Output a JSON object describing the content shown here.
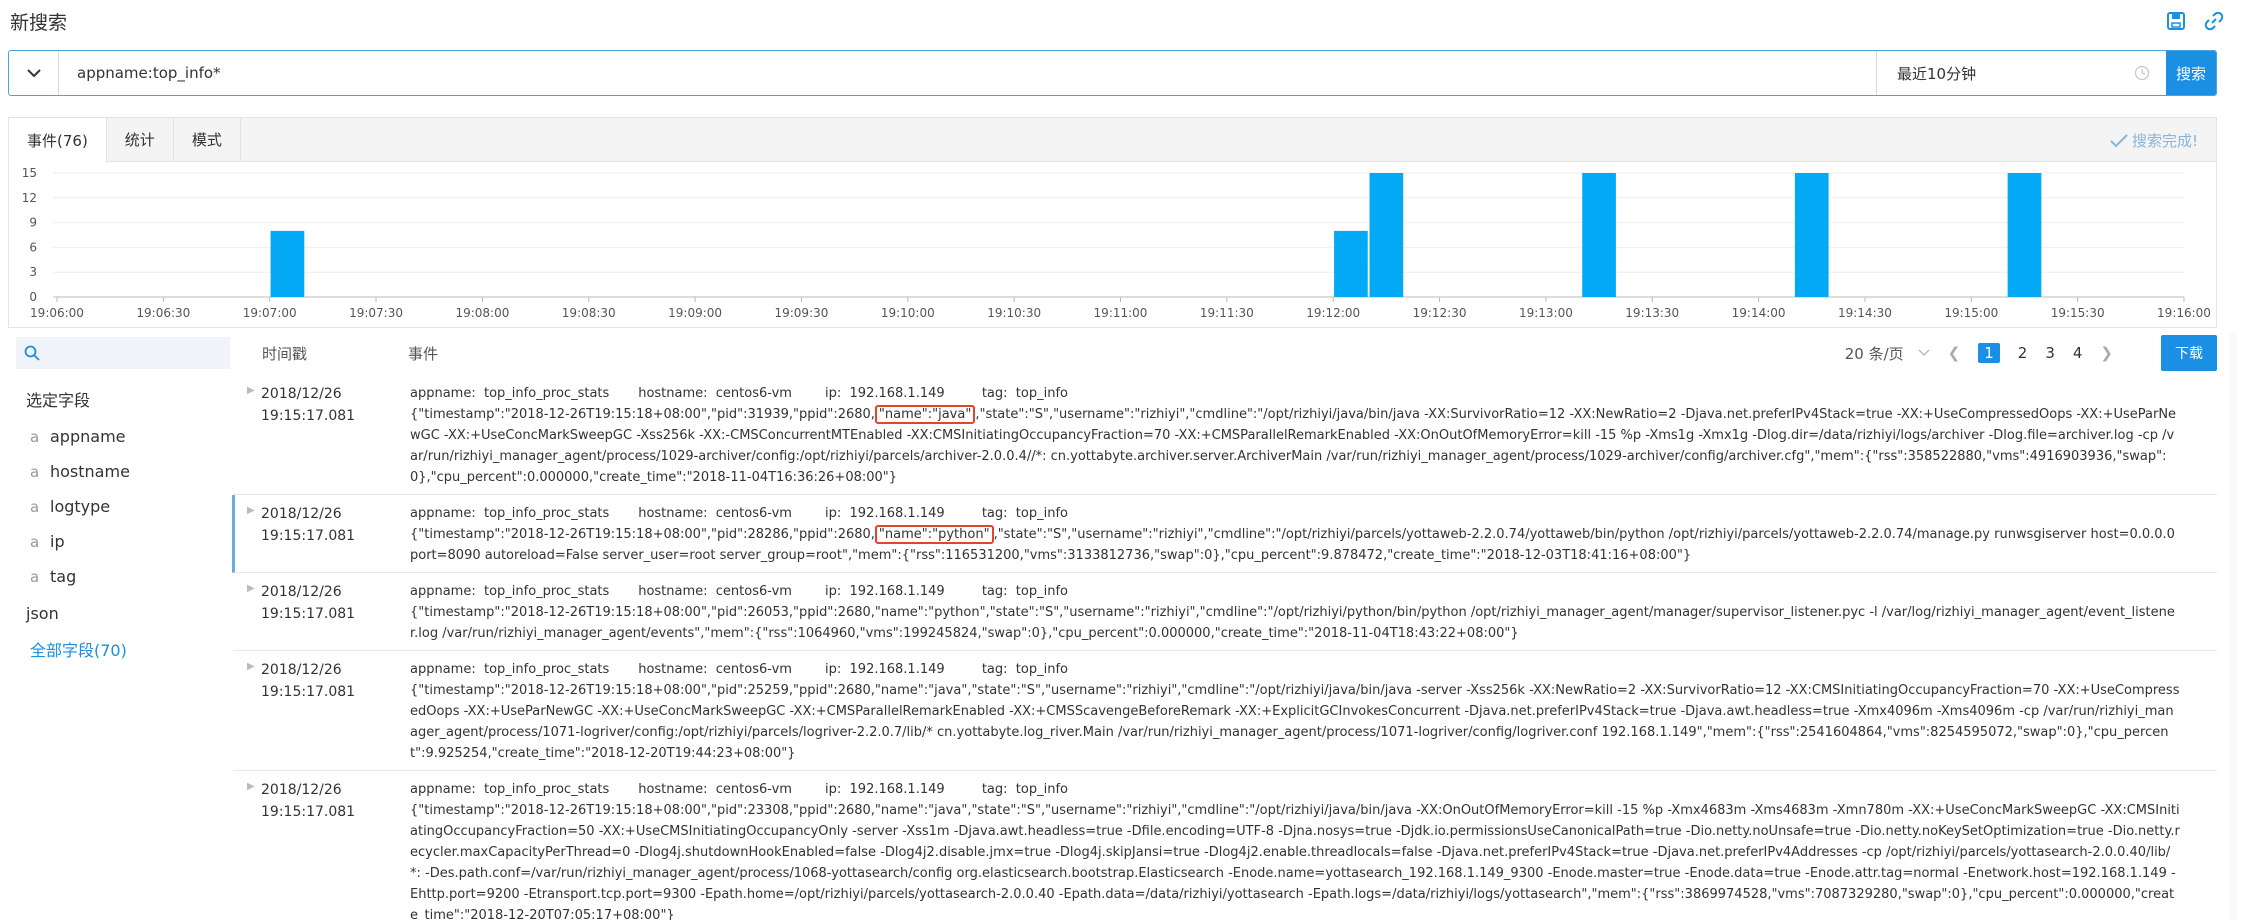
{
  "page": {
    "title": "新搜索"
  },
  "search": {
    "query": "appname:top_info*",
    "time_range": "最近10分钟",
    "button_label": "搜索"
  },
  "tabs": [
    {
      "label": "事件(76)"
    },
    {
      "label": "统计"
    },
    {
      "label": "模式"
    }
  ],
  "status": {
    "search_done": "搜索完成!"
  },
  "chart_data": {
    "type": "bar",
    "y_ticks": [
      "15",
      "12",
      "9",
      "6",
      "3",
      "0"
    ],
    "ylim": [
      0,
      15
    ],
    "x_ticks": [
      "19:06:00",
      "19:06:30",
      "19:07:00",
      "19:07:30",
      "19:08:00",
      "19:08:30",
      "19:09:00",
      "19:09:30",
      "19:10:00",
      "19:10:30",
      "19:11:00",
      "19:11:30",
      "19:12:00",
      "19:12:30",
      "19:13:00",
      "19:13:30",
      "19:14:00",
      "19:14:30",
      "19:15:00",
      "19:15:30",
      "19:16:00"
    ],
    "bars": [
      {
        "time": "19:07:05",
        "value": 8
      },
      {
        "time": "19:12:05",
        "value": 8
      },
      {
        "time": "19:12:15",
        "value": 15
      },
      {
        "time": "19:13:15",
        "value": 15
      },
      {
        "time": "19:14:15",
        "value": 15
      },
      {
        "time": "19:15:15",
        "value": 15
      }
    ],
    "bar_color": "#03a9f4"
  },
  "sidebar": {
    "search_placeholder": "",
    "selected_fields_label": "选定字段",
    "fields": [
      {
        "type": "a",
        "name": "appname"
      },
      {
        "type": "a",
        "name": "hostname"
      },
      {
        "type": "a",
        "name": "logtype"
      },
      {
        "type": "a",
        "name": "ip"
      },
      {
        "type": "a",
        "name": "tag"
      }
    ],
    "json_label": "json",
    "all_fields_label": "全部字段(70)"
  },
  "table": {
    "col_time": "时间戳",
    "col_event": "事件",
    "page_size": "20 条/页",
    "pages": [
      "1",
      "2",
      "3",
      "4"
    ],
    "download_label": "下载"
  },
  "events": [
    {
      "date": "2018/12/26",
      "time": "19:15:17.081",
      "meta": "appname:  top_info_proc_stats       hostname:  centos6-vm        ip:  192.168.1.149         tag:  top_info",
      "pre": "{\"timestamp\":\"2018-12-26T19:15:18+08:00\",\"pid\":31939,\"ppid\":2680,",
      "hl": "\"name\":\"java\"",
      "post": ",\"state\":\"S\",\"username\":\"rizhiyi\",\"cmdline\":\"/opt/rizhiyi/java/bin/java -XX:SurvivorRatio=12 -XX:NewRatio=2 -Djava.net.preferIPv4Stack=true -XX:+UseCompressedOops -XX:+UseParNewGC -XX:+UseConcMarkSweepGC -Xss256k -XX:-CMSConcurrentMTEnabled -XX:CMSInitiatingOccupancyFraction=70 -XX:+CMSParallelRemarkEnabled -XX:OnOutOfMemoryError=kill -15 %p -Xms1g -Xmx1g -Dlog.dir=/data/rizhiyi/logs/archiver -Dlog.file=archiver.log -cp /var/run/rizhiyi_manager_agent/process/1029-archiver/config:/opt/rizhiyi/parcels/archiver-2.0.0.4//*: cn.yottabyte.archiver.server.ArchiverMain /var/run/rizhiyi_manager_agent/process/1029-archiver/config/archiver.cfg\",\"mem\":{\"rss\":358522880,\"vms\":4916903936,\"swap\":0},\"cpu_percent\":0.000000,\"create_time\":\"2018-11-04T16:36:26+08:00\"}",
      "selected": false
    },
    {
      "date": "2018/12/26",
      "time": "19:15:17.081",
      "meta": "appname:  top_info_proc_stats       hostname:  centos6-vm        ip:  192.168.1.149         tag:  top_info",
      "pre": "{\"timestamp\":\"2018-12-26T19:15:18+08:00\",\"pid\":28286,\"ppid\":2680,",
      "hl": "\"name\":\"python\"",
      "post": ",\"state\":\"S\",\"username\":\"rizhiyi\",\"cmdline\":\"/opt/rizhiyi/parcels/yottaweb-2.2.0.74/yottaweb/bin/python /opt/rizhiyi/parcels/yottaweb-2.2.0.74/manage.py runwsgiserver host=0.0.0.0 port=8090 autoreload=False server_user=root server_group=root\",\"mem\":{\"rss\":116531200,\"vms\":3133812736,\"swap\":0},\"cpu_percent\":9.878472,\"create_time\":\"2018-12-03T18:41:16+08:00\"}",
      "selected": true
    },
    {
      "date": "2018/12/26",
      "time": "19:15:17.081",
      "meta": "appname:  top_info_proc_stats       hostname:  centos6-vm        ip:  192.168.1.149         tag:  top_info",
      "pre": "{\"timestamp\":\"2018-12-26T19:15:18+08:00\",\"pid\":26053,\"ppid\":2680,\"name\":\"python\",\"state\":\"S\",\"username\":\"rizhiyi\",\"cmdline\":\"/opt/rizhiyi/python/bin/python /opt/rizhiyi_manager_agent/manager/supervisor_listener.pyc -l /var/log/rizhiyi_manager_agent/event_listener.log /var/run/rizhiyi_manager_agent/events\",\"mem\":{\"rss\":1064960,\"vms\":199245824,\"swap\":0},\"cpu_percent\":0.000000,\"create_time\":\"2018-11-04T18:43:22+08:00\"}",
      "hl": "",
      "post": "",
      "selected": false
    },
    {
      "date": "2018/12/26",
      "time": "19:15:17.081",
      "meta": "appname:  top_info_proc_stats       hostname:  centos6-vm        ip:  192.168.1.149         tag:  top_info",
      "pre": "{\"timestamp\":\"2018-12-26T19:15:18+08:00\",\"pid\":25259,\"ppid\":2680,\"name\":\"java\",\"state\":\"S\",\"username\":\"rizhiyi\",\"cmdline\":\"/opt/rizhiyi/java/bin/java -server -Xss256k -XX:NewRatio=2 -XX:SurvivorRatio=12 -XX:CMSInitiatingOccupancyFraction=70 -XX:+UseCompressedOops -XX:+UseParNewGC -XX:+UseConcMarkSweepGC -XX:+CMSParallelRemarkEnabled -XX:+CMSScavengeBeforeRemark -XX:+ExplicitGCInvokesConcurrent -Djava.net.preferIPv4Stack=true -Djava.awt.headless=true -Xmx4096m -Xms4096m -cp /var/run/rizhiyi_manager_agent/process/1071-logriver/config:/opt/rizhiyi/parcels/logriver-2.2.0.7/lib/* cn.yottabyte.log_river.Main /var/run/rizhiyi_manager_agent/process/1071-logriver/config/logriver.conf 192.168.1.149\",\"mem\":{\"rss\":2541604864,\"vms\":8254595072,\"swap\":0},\"cpu_percent\":9.925254,\"create_time\":\"2018-12-20T19:44:23+08:00\"}",
      "hl": "",
      "post": "",
      "selected": false
    },
    {
      "date": "2018/12/26",
      "time": "19:15:17.081",
      "meta": "appname:  top_info_proc_stats       hostname:  centos6-vm        ip:  192.168.1.149         tag:  top_info",
      "pre": "{\"timestamp\":\"2018-12-26T19:15:18+08:00\",\"pid\":23308,\"ppid\":2680,\"name\":\"java\",\"state\":\"S\",\"username\":\"rizhiyi\",\"cmdline\":\"/opt/rizhiyi/java/bin/java -XX:OnOutOfMemoryError=kill -15 %p -Xmx4683m -Xms4683m -Xmn780m -XX:+UseConcMarkSweepGC -XX:CMSInitiatingOccupancyFraction=50 -XX:+UseCMSInitiatingOccupancyOnly -server -Xss1m -Djava.awt.headless=true -Dfile.encoding=UTF-8 -Djna.nosys=true -Djdk.io.permissionsUseCanonicalPath=true -Dio.netty.noUnsafe=true -Dio.netty.noKeySetOptimization=true -Dio.netty.recycler.maxCapacityPerThread=0 -Dlog4j.shutdownHookEnabled=false -Dlog4j2.disable.jmx=true -Dlog4j.skipJansi=true -Dlog4j2.enable.threadlocals=false -Djava.net.preferIPv4Stack=true -Djava.net.preferIPv4Addresses -cp /opt/rizhiyi/parcels/yottasearch-2.0.0.40/lib/*: -Des.path.conf=/var/run/rizhiyi_manager_agent/process/1068-yottasearch/config org.elasticsearch.bootstrap.Elasticsearch -Enode.name=yottasearch_192.168.1.149_9300 -Enode.master=true -Enode.data=true -Enode.attr.tag=normal -Enetwork.host=192.168.1.149 -Ehttp.port=9200 -Etransport.tcp.port=9300 -Epath.home=/opt/rizhiyi/parcels/yottasearch-2.0.0.40 -Epath.data=/data/rizhiyi/yottasearch -Epath.logs=/data/rizhiyi/logs/yottasearch\",\"mem\":{\"rss\":3869974528,\"vms\":7087329280,\"swap\":0},\"cpu_percent\":0.000000,\"create_time\":\"2018-12-20T07:05:17+08:00\"}",
      "hl": "",
      "post": "",
      "selected": false
    }
  ]
}
